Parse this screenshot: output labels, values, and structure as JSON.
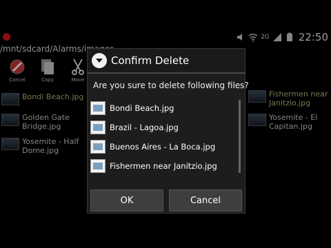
{
  "status": {
    "time": "22:50",
    "network": "2G"
  },
  "path": "/mnt/sdcard/Alarms/images",
  "toolbar": [
    {
      "label": "Cancel",
      "icon": "cancel-icon"
    },
    {
      "label": "Copy",
      "icon": "copy-icon"
    },
    {
      "label": "Move",
      "icon": "scissors-icon"
    }
  ],
  "files_left": [
    {
      "name": "Bondi Beach.jpg",
      "selected": true
    },
    {
      "name": "Golden Gate Bridge.jpg",
      "selected": false
    },
    {
      "name": "Yosemite - Half Dome.jpg",
      "selected": false
    }
  ],
  "files_right": [
    {
      "name": "Fishermen near Janitzio.jpg",
      "selected": true
    },
    {
      "name": "Yosemite - El Capitan.jpg",
      "selected": false
    }
  ],
  "dialog": {
    "title": "Confirm Delete",
    "message": "Are you sure to delete following files?",
    "files": [
      "Bondi Beach.jpg",
      "Brazil - Lagoa.jpg",
      "Buenos Aires - La Boca.jpg",
      "Fishermen near Janitzio.jpg"
    ],
    "ok_label": "OK",
    "cancel_label": "Cancel"
  }
}
